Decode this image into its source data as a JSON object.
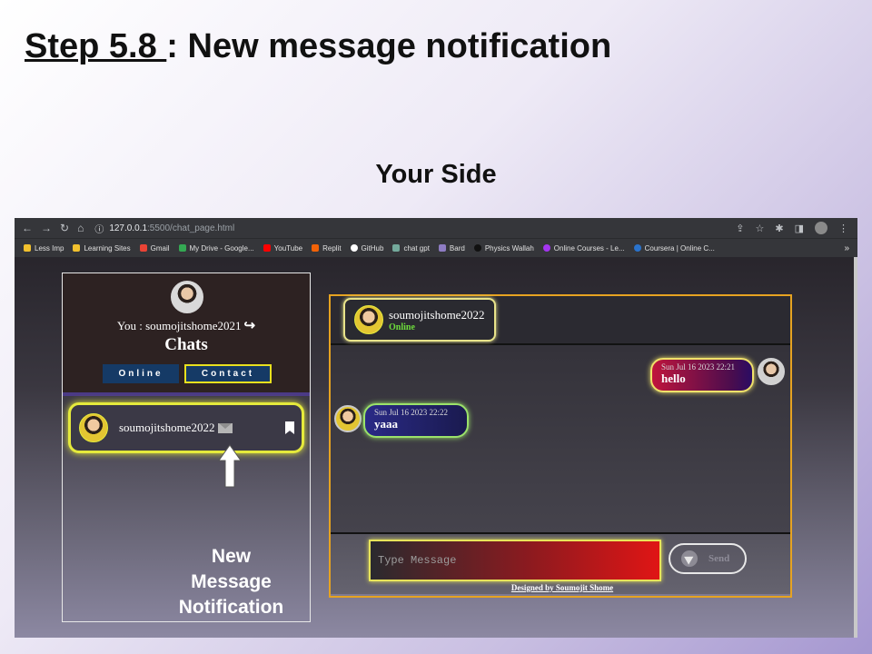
{
  "slide": {
    "step": "Step 5.8 ",
    "title_rest": ":  New message notification",
    "subtitle": "Your Side"
  },
  "browser": {
    "url_host": "127.0.0.1",
    "url_path": ":5500/chat_page.html",
    "bookmarks": [
      {
        "label": "Less Imp",
        "color": "#f2c12e"
      },
      {
        "label": "Learning Sites",
        "color": "#f2c12e"
      },
      {
        "label": "Gmail",
        "color": "#ea4335"
      },
      {
        "label": "My Drive - Google...",
        "color": "#34a853"
      },
      {
        "label": "YouTube",
        "color": "#ff0000"
      },
      {
        "label": "Replit",
        "color": "#f26207"
      },
      {
        "label": "GitHub",
        "color": "#ffffff"
      },
      {
        "label": "chat gpt",
        "color": "#74aa9c"
      },
      {
        "label": "Bard",
        "color": "#8e7cc3"
      },
      {
        "label": "Physics Wallah",
        "color": "#222222"
      },
      {
        "label": "Online Courses - Le...",
        "color": "#a435f0"
      },
      {
        "label": "Coursera | Online C...",
        "color": "#2a73cc"
      }
    ],
    "more": "»"
  },
  "sidebar": {
    "you_label": "You : soumojitshome2021",
    "chats_title": "Chats",
    "tab_online": "Online",
    "tab_contact": "Contact",
    "contact_name": "soumojitshome2022",
    "note": "New Message Notification"
  },
  "chat": {
    "header_name": "soumojitshome2022",
    "header_status": "Online",
    "messages": [
      {
        "time": "Sun Jul 16 2023 22:21",
        "text": "hello"
      },
      {
        "time": "Sun Jul 16 2023 22:22",
        "text": "yaaa"
      }
    ],
    "input_placeholder": "Type Message",
    "send_label": "Send",
    "footer": "Designed by Soumojit Shome"
  }
}
